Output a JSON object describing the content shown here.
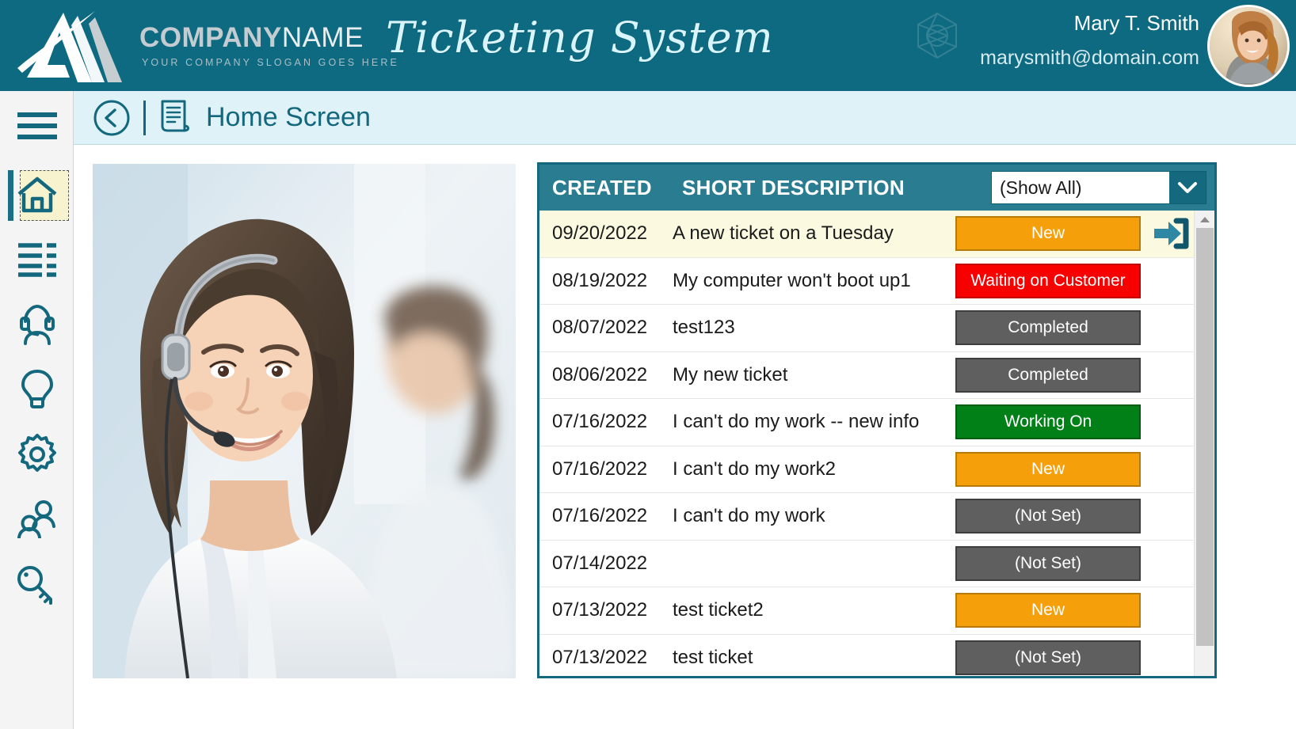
{
  "header": {
    "logo_company": "COMPANY",
    "logo_name": "NAME",
    "logo_slogan": "YOUR COMPANY SLOGAN GOES HERE",
    "app_title": "Ticketing System",
    "user_name": "Mary T. Smith",
    "user_email": "marysmith@domain.com",
    "watermark_icon": "polygon-mesh-icon",
    "avatar_icon": "user-avatar-photo",
    "bg_color": "#0d6a80"
  },
  "breadcrumb": {
    "back_icon": "back-circle-icon",
    "page_icon": "document-icon",
    "title": "Home Screen",
    "bg_color": "#dff2f7"
  },
  "sidebar": {
    "items": [
      {
        "id": "menu",
        "icon": "hamburger-menu-icon",
        "selected": false
      },
      {
        "id": "home",
        "icon": "home-icon",
        "selected": true
      },
      {
        "id": "list",
        "icon": "list-view-icon",
        "selected": false
      },
      {
        "id": "agent",
        "icon": "headset-agent-icon",
        "selected": false
      },
      {
        "id": "ideas",
        "icon": "lightbulb-icon",
        "selected": false
      },
      {
        "id": "settings",
        "icon": "gear-icon",
        "selected": false
      },
      {
        "id": "users",
        "icon": "users-group-icon",
        "selected": false
      },
      {
        "id": "security",
        "icon": "key-icon",
        "selected": false
      }
    ]
  },
  "main": {
    "photo_alt": "call-center-agent-photo",
    "table": {
      "columns": [
        "CREATED",
        "SHORT DESCRIPTION"
      ],
      "filter": {
        "value": "(Show All)",
        "placeholder": "(Show All)",
        "arrow_icon": "chevron-down-icon"
      },
      "rows": [
        {
          "created": "09/20/2022",
          "description": "A new ticket on a Tuesday",
          "status": "New",
          "status_class": "new",
          "selected": true,
          "action_icon": "open-ticket-arrow-icon"
        },
        {
          "created": "08/19/2022",
          "description": "My computer won't boot up1",
          "status": "Waiting on Customer",
          "status_class": "waiting",
          "selected": false,
          "action_icon": ""
        },
        {
          "created": "08/07/2022",
          "description": "test123",
          "status": "Completed",
          "status_class": "completed",
          "selected": false,
          "action_icon": ""
        },
        {
          "created": "08/06/2022",
          "description": "My new ticket",
          "status": "Completed",
          "status_class": "completed",
          "selected": false,
          "action_icon": ""
        },
        {
          "created": "07/16/2022",
          "description": "I can't do my work -- new info",
          "status": "Working On",
          "status_class": "working",
          "selected": false,
          "action_icon": ""
        },
        {
          "created": "07/16/2022",
          "description": "I can't do my work2",
          "status": "New",
          "status_class": "new",
          "selected": false,
          "action_icon": ""
        },
        {
          "created": "07/16/2022",
          "description": "I can't do my work",
          "status": "(Not Set)",
          "status_class": "notset",
          "selected": false,
          "action_icon": ""
        },
        {
          "created": "07/14/2022",
          "description": "",
          "status": "(Not Set)",
          "status_class": "notset",
          "selected": false,
          "action_icon": ""
        },
        {
          "created": "07/13/2022",
          "description": "test ticket2",
          "status": "New",
          "status_class": "new",
          "selected": false,
          "action_icon": ""
        },
        {
          "created": "07/13/2022",
          "description": "test ticket",
          "status": "(Not Set)",
          "status_class": "notset",
          "selected": false,
          "action_icon": ""
        }
      ],
      "scrollbar": {
        "up_icon": "scroll-up-arrow-icon"
      },
      "header_bg": "#2a7d91",
      "border_color": "#14687e"
    }
  },
  "colors": {
    "brand_teal": "#0d6a80",
    "accent_light": "#dff2f7",
    "status_new": "#f5a00a",
    "status_waiting": "#f90000",
    "status_completed": "#5f5f5f",
    "status_working": "#018018",
    "selected_row": "#fbfae0"
  }
}
